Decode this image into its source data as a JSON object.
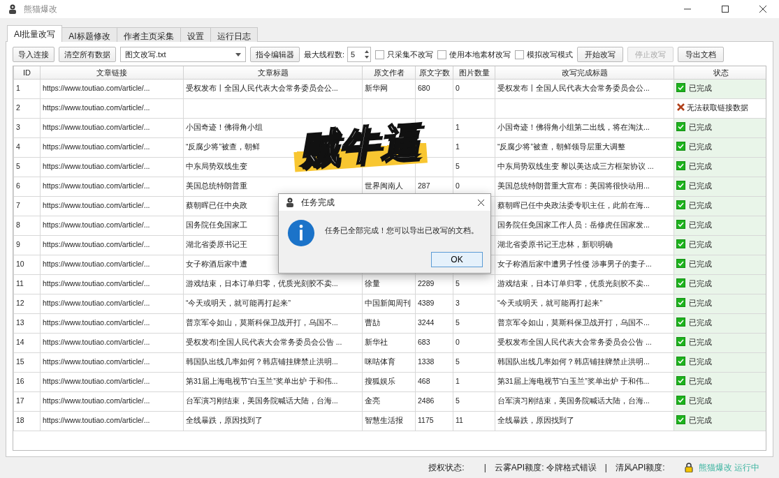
{
  "window": {
    "title": "熊猫爆改"
  },
  "tabs": [
    {
      "label": "AI批量改写",
      "selected": true
    },
    {
      "label": "AI标题修改",
      "selected": false
    },
    {
      "label": "作者主页采集",
      "selected": false
    },
    {
      "label": "设置",
      "selected": false
    },
    {
      "label": "运行日志",
      "selected": false
    }
  ],
  "toolbar": {
    "import_button": "导入连接",
    "clear_button": "清空所有数据",
    "template_select": "图文改写.txt",
    "editor_button": "指令编辑器",
    "threads_label": "最大线程数:",
    "threads_value": "5",
    "checkboxes": [
      {
        "label": "只采集不改写",
        "checked": false
      },
      {
        "label": "使用本地素材改写",
        "checked": false
      },
      {
        "label": "模拟改写模式",
        "checked": false
      }
    ],
    "buttons": [
      {
        "label": "开始改写",
        "disabled": false
      },
      {
        "label": "停止改写",
        "disabled": true
      },
      {
        "label": "导出文档",
        "disabled": false
      }
    ]
  },
  "table": {
    "columns": [
      "ID",
      "文章链接",
      "文章标题",
      "原文作者",
      "原文字数",
      "图片数量",
      "改写完成标题",
      "状态"
    ],
    "rows": [
      {
        "id": "1",
        "link": "https://www.toutiao.com/article/...",
        "title": "受权发布丨全国人民代表大会常务委员会公...",
        "author": "新华网",
        "words": "680",
        "images": "0",
        "new_title": "受权发布丨全国人民代表大会常务委员会公...",
        "status": {
          "kind": "done",
          "text": "已完成"
        }
      },
      {
        "id": "2",
        "link": "https://www.toutiao.com/article/...",
        "status": {
          "kind": "error",
          "text": "无法获取链接数据"
        }
      },
      {
        "id": "3",
        "link": "https://www.toutiao.com/article/...",
        "title": "小国奇迹！佛得角小组",
        "images": "1",
        "new_title": "小国奇迹！佛得角小组第二出线，将在淘汰...",
        "status": {
          "kind": "done",
          "text": "已完成"
        }
      },
      {
        "id": "4",
        "link": "https://www.toutiao.com/article/...",
        "title": "“反腐少将”被查，朝鲜",
        "images": "1",
        "new_title": "“反腐少将”被查，朝鲜领导层重大调整",
        "status": {
          "kind": "done",
          "text": "已完成"
        }
      },
      {
        "id": "5",
        "link": "https://www.toutiao.com/article/...",
        "title": "中东局势双线生变",
        "images": "5",
        "new_title": "中东局势双线生变 黎以美达成三方框架协议 ...",
        "status": {
          "kind": "done",
          "text": "已完成"
        }
      },
      {
        "id": "6",
        "link": "https://www.toutiao.com/article/...",
        "title": "美国总统特朗普重",
        "author": "世界闽南人",
        "words": "287",
        "images": "0",
        "new_title": "美国总统特朗普重大宣布：美国将很快动用...",
        "status": {
          "kind": "done",
          "text": "已完成"
        }
      },
      {
        "id": "7",
        "link": "https://www.toutiao.com/article/...",
        "title": "蔡朝晖已任中央政",
        "new_title": "蔡朝晖已任中央政法委专职主任，此前在海...",
        "status": {
          "kind": "done",
          "text": "已完成"
        }
      },
      {
        "id": "8",
        "link": "https://www.toutiao.com/article/...",
        "title": "国务院任免国家工",
        "new_title": "国务院任免国家工作人员：岳修虎任国家发...",
        "status": {
          "kind": "done",
          "text": "已完成"
        }
      },
      {
        "id": "9",
        "link": "https://www.toutiao.com/article/...",
        "title": "湖北省委原书记王",
        "new_title": "湖北省委原书记王忠林，新职明确",
        "status": {
          "kind": "done",
          "text": "已完成"
        }
      },
      {
        "id": "10",
        "link": "https://www.toutiao.com/article/...",
        "title": "女子称酒后家中遭",
        "new_title": "女子称酒后家中遭男子性侵 涉事男子的妻子...",
        "status": {
          "kind": "done",
          "text": "已完成"
        }
      },
      {
        "id": "11",
        "link": "https://www.toutiao.com/article/...",
        "title": "游戏结束，日本订单归零，优质光刻胶不卖...",
        "author": "徐量",
        "words": "2289",
        "images": "5",
        "new_title": "游戏结束，日本订单归零，优质光刻胶不卖...",
        "status": {
          "kind": "done",
          "text": "已完成"
        }
      },
      {
        "id": "12",
        "link": "https://www.toutiao.com/article/...",
        "title": "“今天或明天，就可能再打起来”",
        "author": "中国新闻周刊",
        "words": "4389",
        "images": "3",
        "new_title": "“今天或明天，就可能再打起来”",
        "status": {
          "kind": "done",
          "text": "已完成"
        }
      },
      {
        "id": "13",
        "link": "https://www.toutiao.com/article/...",
        "title": "普京军令如山，莫斯科保卫战开打，乌国不...",
        "author": "曹劼",
        "words": "3244",
        "images": "5",
        "new_title": "普京军令如山，莫斯科保卫战开打，乌国不...",
        "status": {
          "kind": "done",
          "text": "已完成"
        }
      },
      {
        "id": "14",
        "link": "https://www.toutiao.com/article/...",
        "title": "受权发布|全国人民代表大会常务委员会公告 ...",
        "author": "新华社",
        "words": "683",
        "images": "0",
        "new_title": "受权发布全国人民代表大会常务委员会公告 ...",
        "status": {
          "kind": "done",
          "text": "已完成"
        }
      },
      {
        "id": "15",
        "link": "https://www.toutiao.com/article/...",
        "title": "韩国队出线几率如何？韩店铺挂牌禁止洪明...",
        "author": "咪咕体育",
        "words": "1338",
        "images": "5",
        "new_title": "韩国队出线几率如何？韩店铺挂牌禁止洪明...",
        "status": {
          "kind": "done",
          "text": "已完成"
        }
      },
      {
        "id": "16",
        "link": "https://www.toutiao.com/article/...",
        "title": "第31届上海电视节“白玉兰”奖单出炉 于和伟...",
        "author": "搜狐娱乐",
        "words": "468",
        "images": "1",
        "new_title": "第31届上海电视节“白玉兰”奖单出炉 于和伟...",
        "status": {
          "kind": "done",
          "text": "已完成"
        }
      },
      {
        "id": "17",
        "link": "https://www.toutiao.com/article/...",
        "title": "台军演习刚结束，美国务院喊话大陆，台海...",
        "author": "金亮",
        "words": "2486",
        "images": "5",
        "new_title": "台军演习刚结束，美国务院喊话大陆，台海...",
        "status": {
          "kind": "done",
          "text": "已完成"
        }
      },
      {
        "id": "18",
        "link": "https://www.toutiao.com/article/...",
        "title": "全线暴跌，原因找到了",
        "author": "智慧生活报",
        "words": "1175",
        "images": "11",
        "new_title": "全线暴跌，原因找到了",
        "status": {
          "kind": "done",
          "text": "已完成"
        }
      }
    ]
  },
  "sticker": {
    "text": "贼牛逼"
  },
  "dialog": {
    "title": "任务完成",
    "message": "任务已全部完成！您可以导出已改写的文档。",
    "ok_button": "OK"
  },
  "status_bar": {
    "auth_label": "授权状态:",
    "separator_1": "|",
    "yunwu_quota": "云雾API额度: 令牌格式错误",
    "separator_2": "|",
    "qingfeng_label": "清风API额度:",
    "app_status": "熊猫爆改 运行中"
  }
}
